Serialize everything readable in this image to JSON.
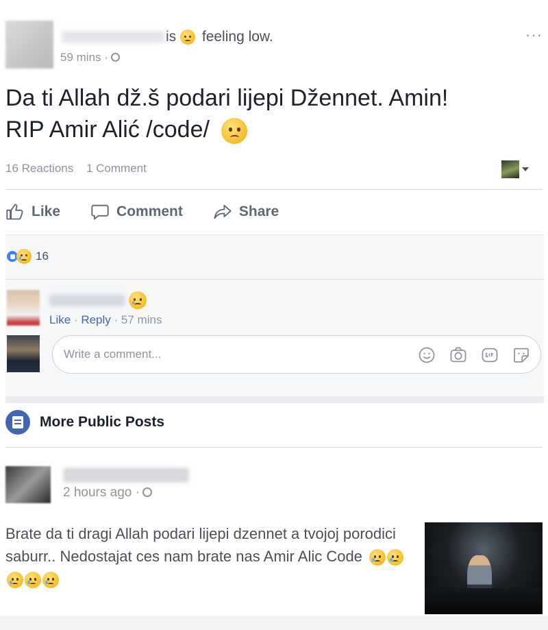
{
  "post": {
    "author_suffix": "is",
    "feeling": "feeling low.",
    "timestamp": "59 mins ·",
    "text_line1": "Da ti Allah dž.š podari lijepi Džennet. Amin!",
    "text_line2": "RIP Amir Alić /code/",
    "reactions_count": "16 Reactions",
    "comments_count": "1 Comment",
    "more_menu": "···"
  },
  "actions": {
    "like": "Like",
    "comment": "Comment",
    "share": "Share"
  },
  "comments_section": {
    "reaction_total": "16",
    "comment": {
      "like": "Like",
      "reply": "Reply",
      "separator": "·",
      "time": "· 57 mins"
    },
    "input_placeholder": "Write a comment...",
    "input_icons": [
      "emoji-icon",
      "camera-icon",
      "gif-icon",
      "sticker-icon"
    ]
  },
  "more_public_posts": {
    "label": "More Public Posts"
  },
  "post2": {
    "timestamp": "2 hours ago ·",
    "text": "Brate da ti dragi Allah podari lijepi dzennet a tvojoj porodici saburr.. Nedostajat ces nam brate nas Amir Alic Code"
  },
  "colors": {
    "link": "#4267b2",
    "meta_text": "#90949c",
    "like_badge": "#4080ff",
    "emoji": "#f7c234"
  }
}
